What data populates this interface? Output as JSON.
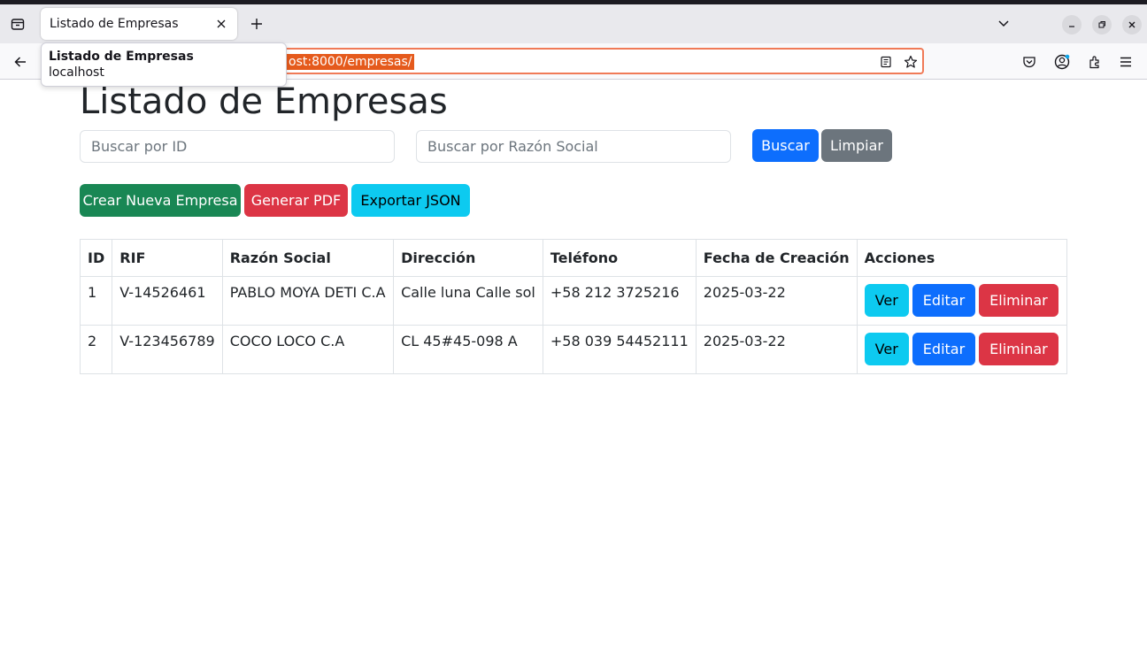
{
  "browser": {
    "tab_title": "Listado de Empresas",
    "url": "ost:8000/empresas/",
    "tooltip_title": "Listado de Empresas",
    "tooltip_host": "localhost",
    "icons": [
      "tab-overview-icon",
      "close-icon",
      "plus-icon",
      "chevron-down-icon",
      "minimize-icon",
      "restore-icon",
      "window-close-icon",
      "back-arrow-icon",
      "reader-view-icon",
      "bookmark-star-icon",
      "pocket-icon",
      "account-icon",
      "extensions-icon",
      "menu-icon"
    ]
  },
  "page": {
    "title": "Listado de Empresas",
    "search_id_placeholder": "Buscar por ID",
    "search_razon_placeholder": "Buscar por Razón Social",
    "buscar_label": "Buscar",
    "limpiar_label": "Limpiar",
    "crear_label": "Crear Nueva Empresa",
    "pdf_label": "Generar PDF",
    "json_label": "Exportar JSON"
  },
  "table": {
    "headers": [
      "ID",
      "RIF",
      "Razón Social",
      "Dirección",
      "Teléfono",
      "Fecha de Creación",
      "Acciones"
    ],
    "rows": [
      {
        "id": "1",
        "rif": "V-14526461",
        "razon": "PABLO MOYA DETI C.A",
        "direccion": "Calle luna Calle sol",
        "telefono": "+58 212 3725216",
        "fecha": "2025-03-22"
      },
      {
        "id": "2",
        "rif": "V-123456789",
        "razon": "COCO LOCO C.A",
        "direccion": "CL 45#45-098 A",
        "telefono": "+58 039 54452111",
        "fecha": "2025-03-22"
      }
    ],
    "actions": {
      "ver": "Ver",
      "editar": "Editar",
      "eliminar": "Eliminar"
    }
  },
  "colors": {
    "primary": "#0d6efd",
    "secondary": "#6c757d",
    "success": "#198754",
    "danger": "#dc3545",
    "info": "#0dcaf0",
    "url_highlight": "#e55a1c"
  }
}
